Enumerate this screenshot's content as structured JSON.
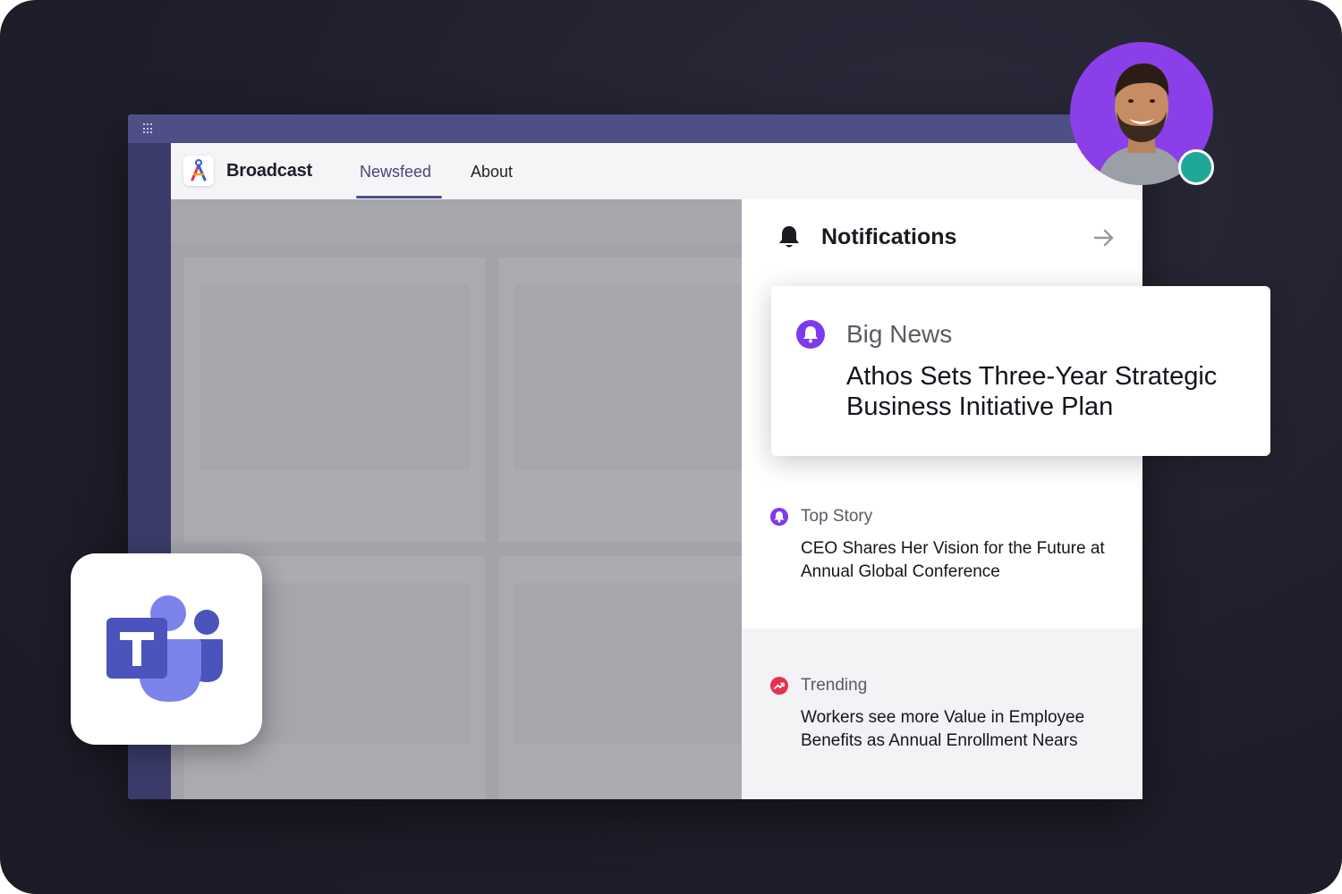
{
  "app": {
    "brand": "Broadcast",
    "tabs": [
      {
        "label": "Newsfeed",
        "active": true
      },
      {
        "label": "About",
        "active": false
      }
    ]
  },
  "notifications": {
    "title": "Notifications",
    "featured": {
      "category": "Big News",
      "headline": "Athos Sets Three-Year Strategic Business Initiative Plan",
      "icon": "bell-icon",
      "color": "#7c3aed"
    },
    "items": [
      {
        "category": "Top Story",
        "headline": "CEO Shares Her Vision for the Future at Annual Global Conference",
        "icon": "bell-icon",
        "color": "#7c3aed"
      },
      {
        "category": "Trending",
        "headline": "Workers see more Value in Employee Benefits as Annual Enrollment Nears",
        "icon": "trending-icon",
        "color": "#e8314f"
      }
    ]
  },
  "colors": {
    "accent": "#4e4f86",
    "online": "#1fa898",
    "avatar_bg": "#8b3fe8"
  }
}
